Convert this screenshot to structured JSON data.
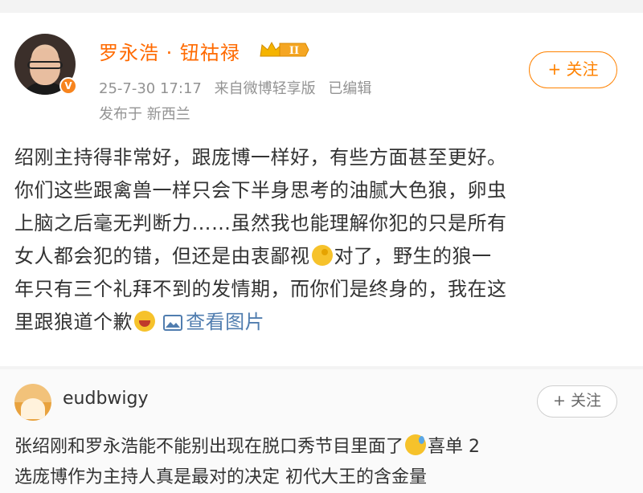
{
  "post": {
    "author": "罗永浩 · 钮祜禄",
    "level_badge": "II",
    "verified_mark": "V",
    "date": "25-7-30 17:17",
    "source": "来自微博轻享版",
    "edited": "已编辑",
    "location": "发布于 新西兰",
    "follow_label": "+ 关注",
    "text_lines": [
      "绍刚主持得非常好，跟庞博一样好，有些方面甚至更好。",
      "你们这些跟禽兽一样只会下半身思考的油腻大色狼，卵虫",
      "上脑之后毫无判断力……虽然我也能理解你犯的只是所有",
      "女人都会犯的错，但还是由衷鄙视",
      "对了，野生的狼一",
      "年只有三个礼拜不到的发情期，而你们是终身的，我在这",
      "里跟狼道个歉"
    ],
    "view_pictures": "查看图片"
  },
  "comment": {
    "username": "eudbwigy",
    "follow_label": "+ 关注",
    "text_line1": "张绍刚和罗永浩能不能别出现在脱口秀节目里面了",
    "text_line1_tail": "喜单 2",
    "text_line2": "选庞博作为主持人真是最对的决定 初代大王的含金量"
  },
  "colors": {
    "author_orange": "#ff6a00",
    "follow_orange": "#ff8200",
    "link_blue": "#507daf",
    "meta_gray": "#939393"
  },
  "icons": [
    "crown-badge-icon",
    "verified-v-icon",
    "thinking-emoji-icon",
    "laugh-emoji-icon",
    "picture-icon",
    "sweat-emoji-icon"
  ]
}
